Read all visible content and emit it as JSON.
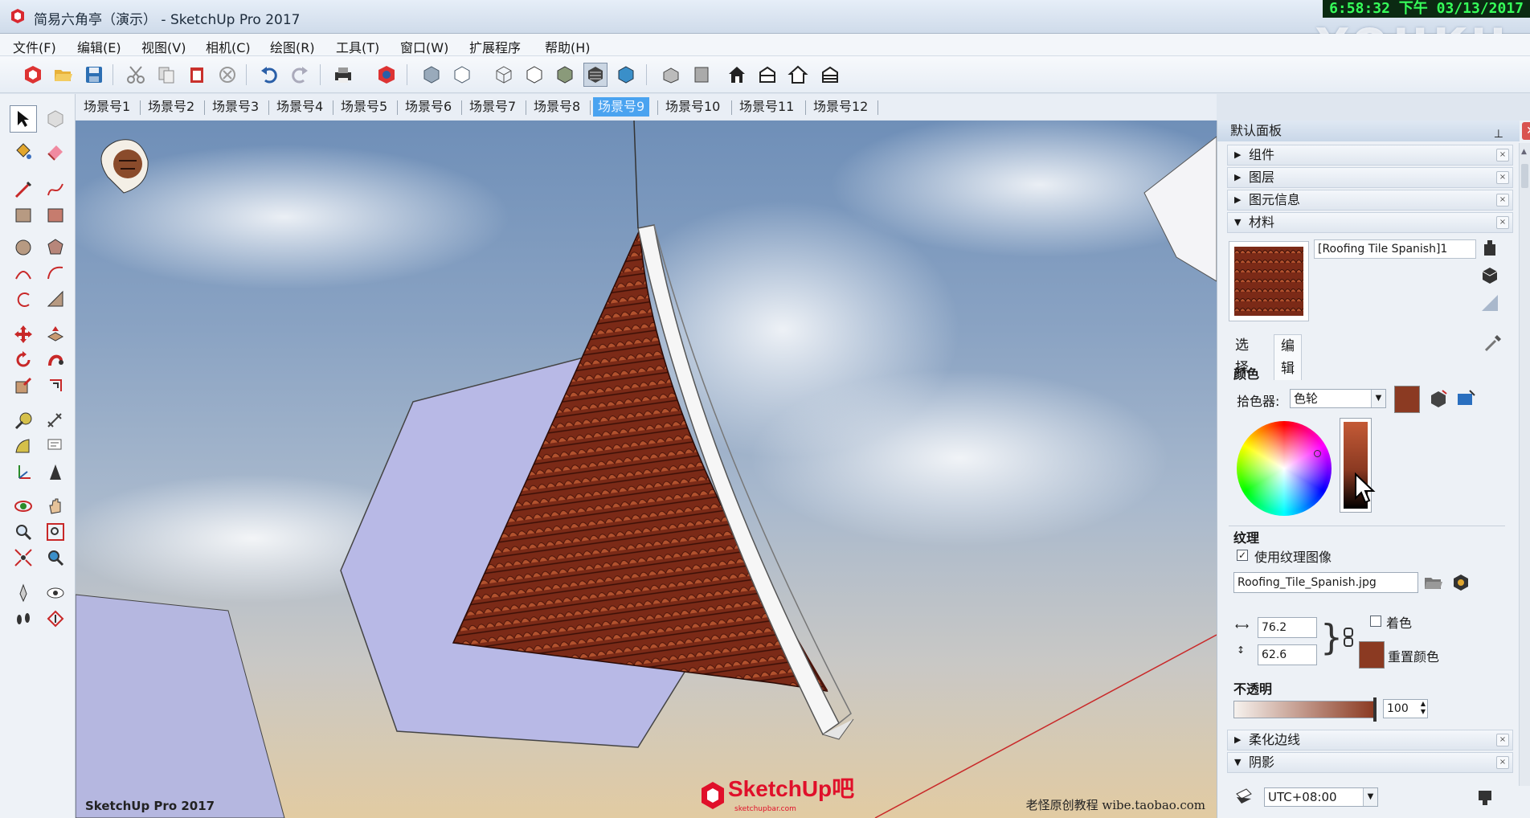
{
  "window": {
    "title": "简易六角亭（演示） - SketchUp Pro 2017",
    "clock": "6:58:32 下午 03/13/2017",
    "watermark": "YOUKU"
  },
  "menu": [
    "文件(F)",
    "编辑(E)",
    "视图(V)",
    "相机(C)",
    "绘图(R)",
    "工具(T)",
    "窗口(W)",
    "扩展程序",
    "帮助(H)"
  ],
  "scenes": {
    "tabs": [
      "场景号1",
      "场景号2",
      "场景号3",
      "场景号4",
      "场景号5",
      "场景号6",
      "场景号7",
      "场景号8",
      "场景号9",
      "场景号10",
      "场景号11",
      "场景号12"
    ],
    "active_index": 8
  },
  "viewport": {
    "footer_label": "SketchUp Pro 2017",
    "credit": "老怪原创教程  wibe.taobao.com",
    "logo": "SketchUp吧",
    "logo_sub": "sketchupbar.com"
  },
  "tray": {
    "title": "默认面板",
    "pin_icon": "pin-icon",
    "sections_top": [
      {
        "label": "组件",
        "expanded": false
      },
      {
        "label": "图层",
        "expanded": false
      },
      {
        "label": "图元信息",
        "expanded": false
      },
      {
        "label": "材料",
        "expanded": true
      }
    ],
    "material": {
      "name": "[Roofing Tile Spanish]1",
      "tabs": [
        "选择",
        "编辑"
      ],
      "active_tab": "编辑",
      "color_heading": "颜色",
      "picker_label": "拾色器:",
      "picker_value": "色轮",
      "color_hex": "#8b3a22",
      "texture_heading": "纹理",
      "use_texture_label": "使用纹理图像",
      "use_texture_checked": true,
      "texture_file": "Roofing_Tile_Spanish.jpg",
      "width_value": "76.2",
      "height_value": "62.6",
      "colorize_label": "着色",
      "colorize_checked": false,
      "reset_color_label": "重置颜色",
      "opacity_heading": "不透明",
      "opacity_value": "100"
    },
    "sections_bottom": [
      {
        "label": "柔化边线",
        "expanded": false
      },
      {
        "label": "阴影",
        "expanded": true
      }
    ],
    "shadow": {
      "timezone": "UTC+08:00"
    }
  }
}
